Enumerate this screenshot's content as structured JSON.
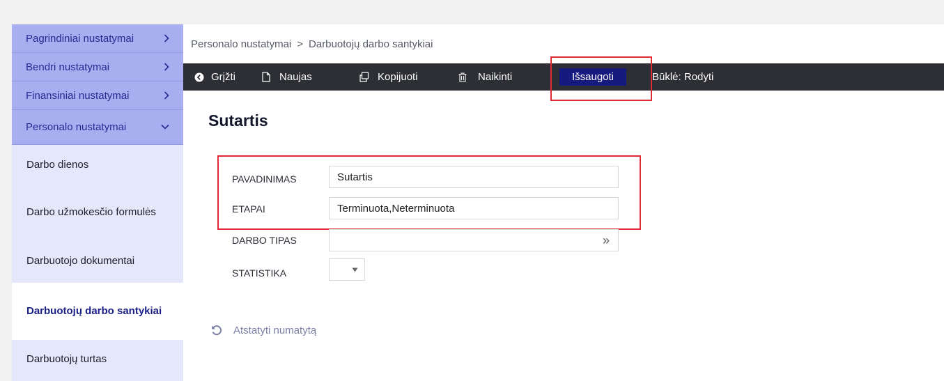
{
  "sidebar": {
    "categories": [
      {
        "label": "Pagrindiniai nustatymai",
        "icon": "chevron-right-icon"
      },
      {
        "label": "Bendri nustatymai",
        "icon": "chevron-right-icon"
      },
      {
        "label": "Finansiniai nustatymai",
        "icon": "chevron-right-icon"
      },
      {
        "label": "Personalo nustatymai",
        "icon": "chevron-down-icon"
      }
    ],
    "items": [
      {
        "label": "Darbo dienos"
      },
      {
        "label": "Darbo užmokesčio formulės"
      },
      {
        "label": "Darbuotojo dokumentai"
      },
      {
        "label": "Darbuotojų darbo santykiai",
        "active": true
      },
      {
        "label": "Darbuotojų turtas"
      }
    ]
  },
  "breadcrumb": {
    "parent": "Personalo nustatymai",
    "separator": ">",
    "current": "Darbuotojų darbo santykiai"
  },
  "toolbar": {
    "back_label": "Grįžti",
    "new_label": "Naujas",
    "copy_label": "Kopijuoti",
    "delete_label": "Naikinti",
    "save_label": "Išsaugoti",
    "status_label": "Būklė: Rodyti"
  },
  "form": {
    "title": "Sutartis",
    "fields": {
      "name": {
        "label": "PAVADINIMAS",
        "value": "Sutartis"
      },
      "stages": {
        "label": "ETAPAI",
        "value": "Terminuota,Neterminuota"
      },
      "work_type": {
        "label": "DARBO TIPAS",
        "value": "",
        "arrow": "»"
      },
      "statistics": {
        "label": "STATISTIKA",
        "value": ""
      }
    },
    "reset_label": "Atstatyti numatytą"
  },
  "colors": {
    "sidebar_category_bg": "#a8aef0",
    "sidebar_bg": "#e5e7fa",
    "toolbar_bg": "#2d2f35",
    "save_button_bg": "#161a7e",
    "highlight": "#e02a34",
    "active_item_text": "#1b2186"
  }
}
